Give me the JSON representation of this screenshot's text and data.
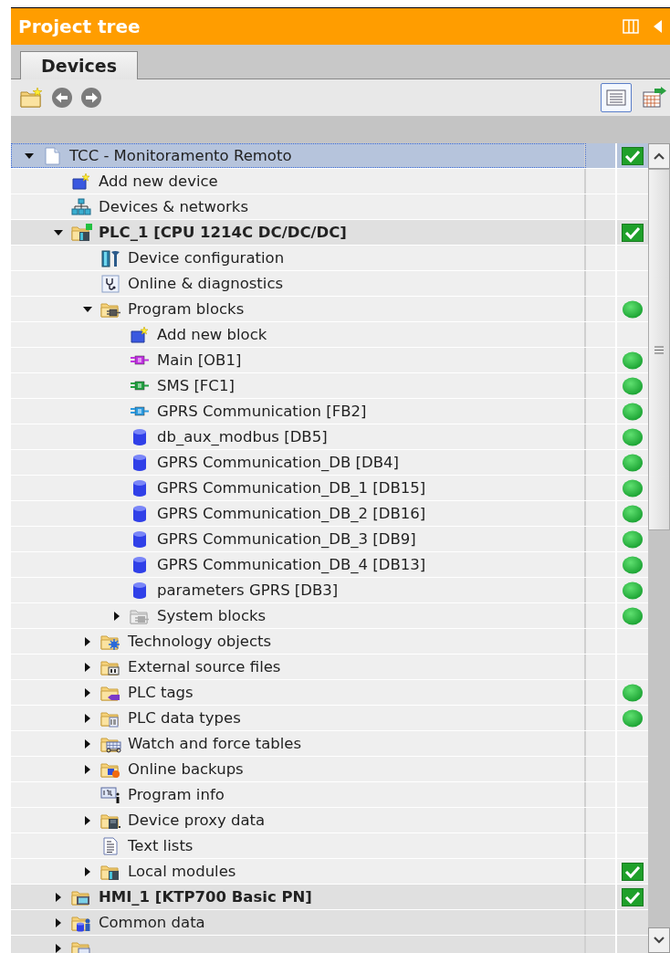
{
  "header": {
    "title": "Project tree"
  },
  "tabs": [
    {
      "label": "Devices",
      "selected": true
    }
  ],
  "toolbar": [
    {
      "kind": "new-folder"
    },
    {
      "kind": "back"
    },
    {
      "kind": "forward"
    },
    {
      "kind": "details-view",
      "selected": true
    },
    {
      "kind": "export",
      "selected": false
    }
  ],
  "tree": [
    {
      "label": "TCC - Monitoramento Remoto",
      "kind": "project",
      "selected": true,
      "expanded": true,
      "status": {
        "kind": "check"
      },
      "children": [
        {
          "label": "Add new device",
          "kind": "add-device",
          "selected": false
        },
        {
          "label": "Devices & networks",
          "kind": "network",
          "selected": false
        },
        {
          "label": "PLC_1 [CPU 1214C DC/DC/DC]",
          "kind": "plc",
          "selected": false,
          "expanded": true,
          "status": {
            "kind": "check"
          },
          "children": [
            {
              "label": "Device configuration",
              "kind": "config",
              "selected": false
            },
            {
              "label": "Online & diagnostics",
              "kind": "diagnostics",
              "selected": false
            },
            {
              "label": "Program blocks",
              "kind": "blocks-folder",
              "selected": false,
              "expanded": true,
              "status": {
                "kind": "dot"
              },
              "children": [
                {
                  "label": "Add new block",
                  "kind": "add-block",
                  "selected": false
                },
                {
                  "label": "Main [OB1]",
                  "kind": "ob",
                  "selected": false,
                  "status": {
                    "kind": "dot"
                  }
                },
                {
                  "label": "SMS [FC1]",
                  "kind": "fc",
                  "selected": false,
                  "status": {
                    "kind": "dot"
                  }
                },
                {
                  "label": "GPRS Communication [FB2]",
                  "kind": "fb",
                  "selected": false,
                  "status": {
                    "kind": "dot"
                  }
                },
                {
                  "label": "db_aux_modbus [DB5]",
                  "kind": "db",
                  "selected": false,
                  "status": {
                    "kind": "dot"
                  }
                },
                {
                  "label": "GPRS Communication_DB [DB4]",
                  "kind": "db",
                  "selected": false,
                  "status": {
                    "kind": "dot"
                  }
                },
                {
                  "label": "GPRS Communication_DB_1 [DB15]",
                  "kind": "db",
                  "selected": false,
                  "status": {
                    "kind": "dot"
                  }
                },
                {
                  "label": "GPRS Communication_DB_2 [DB16]",
                  "kind": "db",
                  "selected": false,
                  "status": {
                    "kind": "dot"
                  }
                },
                {
                  "label": "GPRS Communication_DB_3 [DB9]",
                  "kind": "db",
                  "selected": false,
                  "status": {
                    "kind": "dot"
                  }
                },
                {
                  "label": "GPRS Communication_DB_4 [DB13]",
                  "kind": "db",
                  "selected": false,
                  "status": {
                    "kind": "dot"
                  }
                },
                {
                  "label": "parameters GPRS [DB3]",
                  "kind": "db",
                  "selected": false,
                  "status": {
                    "kind": "dot"
                  }
                },
                {
                  "label": "System blocks",
                  "kind": "system-folder",
                  "selected": false,
                  "expanded": false,
                  "status": {
                    "kind": "dot"
                  }
                }
              ]
            },
            {
              "label": "Technology objects",
              "kind": "tech-folder",
              "selected": false,
              "expanded": false
            },
            {
              "label": "External source files",
              "kind": "source-folder",
              "selected": false,
              "expanded": false
            },
            {
              "label": "PLC tags",
              "kind": "tags-folder",
              "selected": false,
              "expanded": false,
              "status": {
                "kind": "dot"
              }
            },
            {
              "label": "PLC data types",
              "kind": "types-folder",
              "selected": false,
              "expanded": false,
              "status": {
                "kind": "dot"
              }
            },
            {
              "label": "Watch and force tables",
              "kind": "watch-folder",
              "selected": false,
              "expanded": false
            },
            {
              "label": "Online backups",
              "kind": "backup-folder",
              "selected": false,
              "expanded": false
            },
            {
              "label": "Program info",
              "kind": "program-info",
              "selected": false
            },
            {
              "label": "Device proxy data",
              "kind": "proxy-folder",
              "selected": false,
              "expanded": false
            },
            {
              "label": "Text lists",
              "kind": "text-lists",
              "selected": false
            },
            {
              "label": "Local modules",
              "kind": "modules-folder",
              "selected": false,
              "expanded": false,
              "status": {
                "kind": "check"
              }
            }
          ]
        },
        {
          "label": "HMI_1 [KTP700 Basic PN]",
          "kind": "hmi",
          "selected": false,
          "expanded": false,
          "status": {
            "kind": "check"
          }
        },
        {
          "label": "Common data",
          "kind": "common-data",
          "selected": false,
          "expanded": false
        },
        {
          "kind": "doc-folder",
          "selected": false,
          "expanded": false
        }
      ]
    }
  ]
}
